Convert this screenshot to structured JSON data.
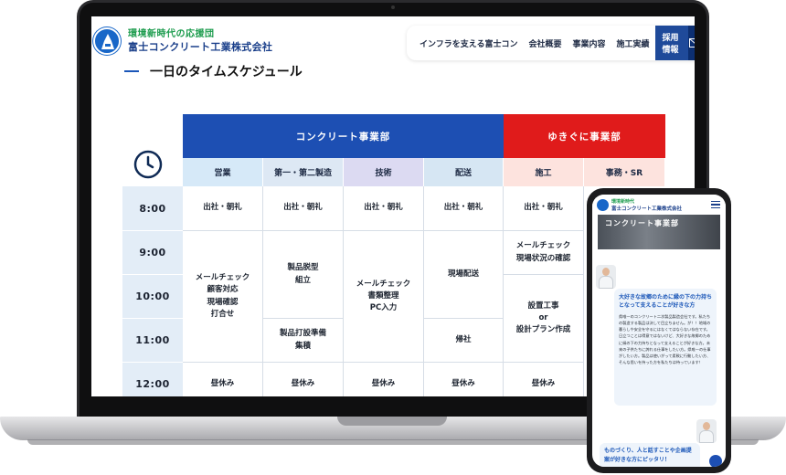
{
  "site": {
    "tagline": "環境新時代の応援団",
    "company": "富士コンクリート工業株式会社"
  },
  "nav": {
    "items": [
      "インフラを支える富士コン",
      "会社概要",
      "事業内容",
      "施工実績"
    ],
    "recruit": "採用情報",
    "mail_icon": "mail-icon"
  },
  "section": {
    "title": "一日のタイムスケジュール"
  },
  "schedule": {
    "departments": [
      "コンクリート事業部",
      "ゆきぐに事業部"
    ],
    "columns": [
      "営業",
      "第一・第二製造",
      "技術",
      "配送",
      "施工",
      "事務・SR"
    ],
    "times": [
      "8:00",
      "9:00",
      "10:00",
      "11:00",
      "12:00"
    ],
    "cells": {
      "c1_8": "出社・朝礼",
      "c2_8": "出社・朝礼",
      "c3_8": "出社・朝礼",
      "c4_8": "出社・朝礼",
      "c5_8": "出社・朝礼",
      "c1_9": "メールチェック\n顧客対応\n現場確認\n打合せ",
      "c2_9": "製品脱型\n組立",
      "c2_11": "製品打設準備\n集積",
      "c3_9": "メールチェック\n書類整理\nPC入力",
      "c4_9": "現場配送",
      "c4_11": "帰社",
      "c5_9": "メールチェック\n現場状況の確認",
      "c5_10": "設置工事\nor\n設計プラン作成",
      "c1_12": "昼休み",
      "c2_12": "昼休み",
      "c3_12": "昼休み",
      "c4_12": "昼休み",
      "c5_12": "昼休み"
    }
  },
  "colors": {
    "concrete": "#1d4fb3",
    "yukiguni": "#e01b1b",
    "col_headers": [
      "#d6e9f8",
      "#dde8f4",
      "#dcdaf2",
      "#d6e6f3",
      "#fde3de",
      "#fde3de"
    ]
  },
  "phone": {
    "tagline": "環境新時代",
    "company": "富士コンクリート工業株式会社",
    "hero_title": "コンクリート事業部",
    "bubble_heading": "大好きな故郷のために縁の下の力持ちとなって支えることが好きな方",
    "bubble_body": "県唯一のコンクリート二次製品製造会社です。私たちの製造する製品は決して目立ちません。が！！地域の暮らしや安全を守るにはなくてはならない存在です。日立つことは得意ではないけど、大好きな故郷のために縁の下の力持ちとなって支えることが好きな方。未来の子供たちに誇れる仕事をしたい方。県唯一の仕事がしたい方。製品は使いがって柔軟に行動したい方、そんな思いを持った方を私たちは待っています！",
    "bubble2_heading": "ものづくり、人と話すことや企画提案が好きな方にピッタリ！"
  }
}
